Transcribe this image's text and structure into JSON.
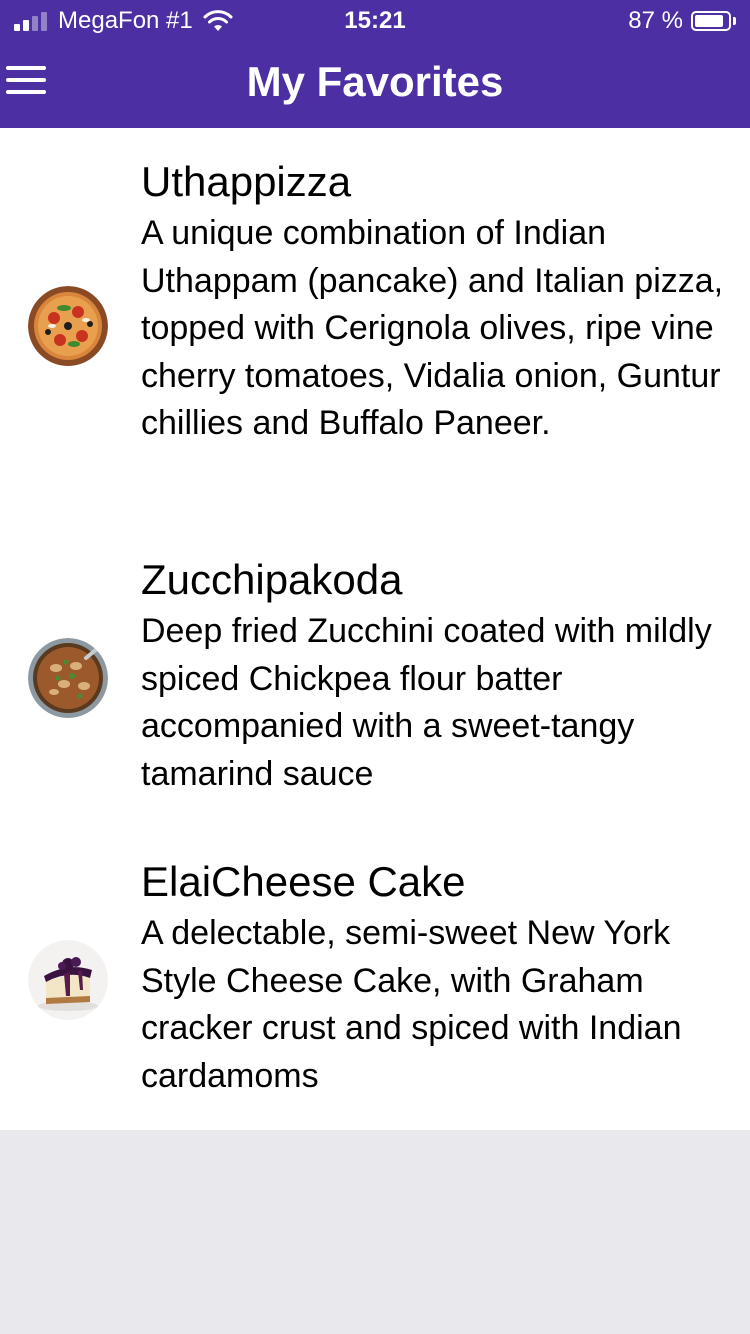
{
  "status_bar": {
    "carrier": "MegaFon #1",
    "time": "15:21",
    "battery_percent": "87 %",
    "battery_level": 0.87,
    "signal_bars_filled": 2,
    "signal_bars_total": 4
  },
  "header": {
    "title": "My Favorites",
    "background_color": "#4b2fa3"
  },
  "favorites": [
    {
      "name": "Uthappizza",
      "description": "A unique combination of Indian Uthappam (pancake) and Italian pizza, topped with Cerignola olives, ripe vine cherry tomatoes, Vidalia onion, Guntur chillies and Buffalo Paneer.",
      "image": "pizza-thumbnail"
    },
    {
      "name": "Zucchipakoda",
      "description": "Deep fried Zucchini coated with mildly spiced Chickpea flour batter accompanied with a sweet-tangy tamarind sauce",
      "image": "pakoda-bowl-thumbnail"
    },
    {
      "name": "ElaiCheese Cake",
      "description": "A delectable, semi-sweet New York Style Cheese Cake, with Graham cracker crust and spiced with Indian cardamoms",
      "image": "cheesecake-thumbnail"
    }
  ]
}
